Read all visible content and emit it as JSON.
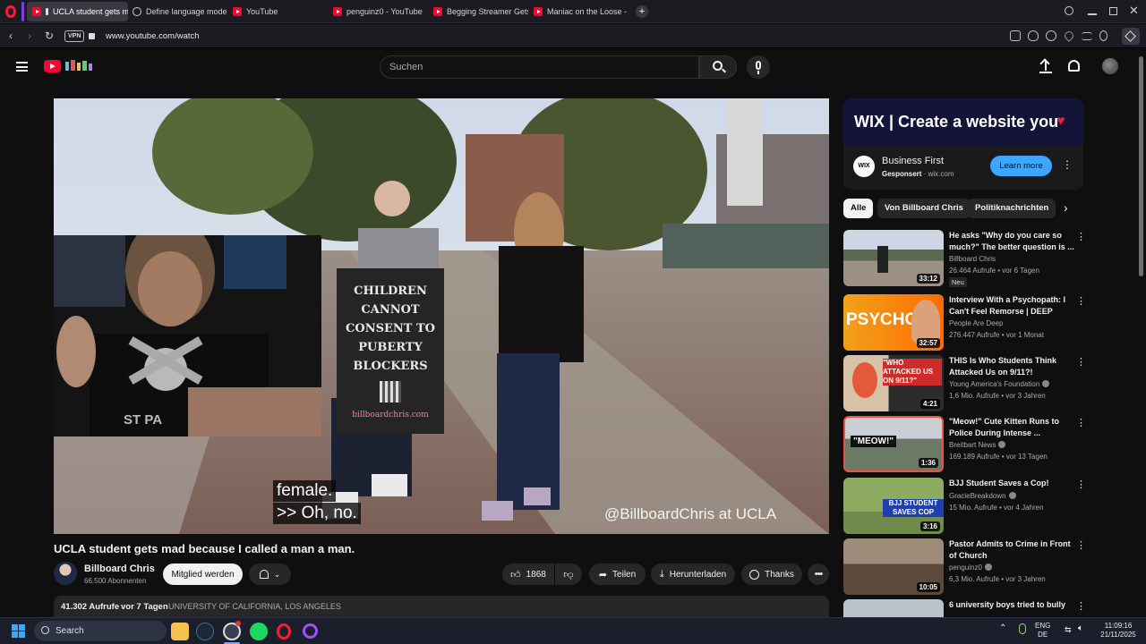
{
  "browser": {
    "tabs": [
      {
        "title": "UCLA student gets ma",
        "favicon": "youtube-icon",
        "active": true
      },
      {
        "title": "Define language model",
        "favicon": "globe-icon"
      },
      {
        "title": "YouTube",
        "favicon": "youtube-icon"
      },
      {
        "title": "penguinz0 - YouTube",
        "favicon": "youtube-icon"
      },
      {
        "title": "Begging Streamer Gets Ca",
        "favicon": "youtube-icon"
      },
      {
        "title": "Maniac on the Loose - Yo",
        "favicon": "youtube-icon"
      }
    ],
    "vpn_label": "VPN",
    "url": "www.youtube.com/watch"
  },
  "header": {
    "search_placeholder": "Suchen"
  },
  "video": {
    "caption_line1": "female.",
    "caption_line2": ">> Oh, no.",
    "watermark": "@BillboardChris at UCLA",
    "sign_text": [
      "CHILDREN",
      "CANNOT",
      "CONSENT TO",
      "PUBERTY",
      "BLOCKERS"
    ],
    "sign_url": "billboardchris.com",
    "webcam_shirt_text": "ST PA",
    "title": "UCLA student gets mad because I called a man a man.",
    "channel": "Billboard Chris",
    "subscribers": "66.500 Abonnenten",
    "join_label": "Mitglied werden",
    "likes": "1868",
    "share_label": "Teilen",
    "download_label": "Herunterladen",
    "thanks_label": "Thanks",
    "views": "41.302 Aufrufe",
    "age": "vor 7 Tagen",
    "location": "UNIVERSITY OF CALIFORNIA, LOS ANGELES"
  },
  "ad": {
    "banner_text": "WIX | Create a website you",
    "logo_text": "WIX",
    "title": "Business First",
    "sponsored": "Gesponsert",
    "domain": "wix.com",
    "cta": "Learn more",
    "accent": "#3ea6ff"
  },
  "chips": [
    "Alle",
    "Von Billboard Chris",
    "Politiknachrichten"
  ],
  "recommendations": [
    {
      "title": "He asks \"Why do you care so much?\" The better question is ...",
      "channel": "Billboard Chris",
      "verified": false,
      "meta": "26.464 Aufrufe • vor 6 Tagen",
      "duration": "33:12",
      "badge": "Neu"
    },
    {
      "title": "Interview With a Psychopath: I Can't Feel Remorse | DEEP",
      "channel": "People Are Deep",
      "verified": false,
      "meta": "276.447 Aufrufe • vor 1 Monat",
      "duration": "32:57",
      "thumb_text": "PSYCHO"
    },
    {
      "title": "THIS Is Who Students Think Attacked Us on 9/11?!",
      "channel": "Young America's Foundation",
      "verified": true,
      "meta": "1,6 Mio. Aufrufe • vor 3 Jahren",
      "duration": "4:21",
      "thumb_text": "\"WHO ATTACKED US ON 9/11?\""
    },
    {
      "title": "\"Meow!\" Cute Kitten Runs to Police During Intense ...",
      "channel": "Breitbart News",
      "verified": true,
      "meta": "169.189 Aufrufe • vor 13 Tagen",
      "duration": "1:36",
      "thumb_text": "\"MEOW!\""
    },
    {
      "title": "BJJ Student Saves a Cop!",
      "channel": "GracieBreakdown",
      "verified": true,
      "meta": "15 Mio. Aufrufe • vor 4 Jahren",
      "duration": "3:16",
      "thumb_text": "BJJ STUDENT SAVES COP"
    },
    {
      "title": "Pastor Admits to Crime in Front of Church",
      "channel": "penguinz0",
      "verified": true,
      "meta": "6,3 Mio. Aufrufe • vor 3 Jahren",
      "duration": "10:05"
    },
    {
      "title": "6 university boys tried to bully",
      "channel": "",
      "verified": false,
      "meta": "",
      "duration": ""
    }
  ],
  "taskbar": {
    "search_label": "Search",
    "lang1": "ENG",
    "lang2": "DE",
    "time": "11:09:16",
    "date": "21/11/2025"
  },
  "colors": {
    "youtube_red": "#ff0033",
    "background": "#0f0f0f",
    "chip_bg": "#272727"
  }
}
